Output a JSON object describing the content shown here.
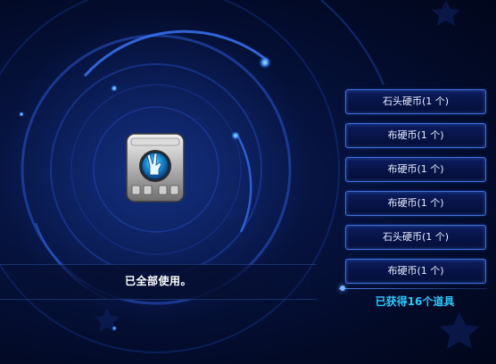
{
  "rewards": [
    {
      "label": "石头硬币(1 个)"
    },
    {
      "label": "布硬币(1 个)"
    },
    {
      "label": "布硬币(1 个)"
    },
    {
      "label": "布硬币(1 个)"
    },
    {
      "label": "石头硬币(1 个)"
    },
    {
      "label": "布硬币(1 个)"
    }
  ],
  "status": {
    "message": "已全部使用。"
  },
  "summary": {
    "total_text": "已获得16个道具"
  },
  "item": {
    "icon": "victory-hand-coin-box-icon"
  },
  "colors": {
    "accent": "#2ec8ff",
    "button_border": "#3f6fd8",
    "background": "#06123d"
  }
}
